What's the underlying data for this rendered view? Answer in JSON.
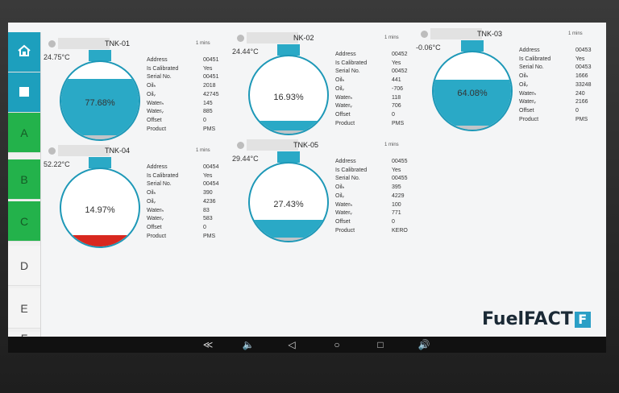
{
  "sidebar": {
    "items": [
      {
        "label": "⌂",
        "icon": "home-icon"
      },
      {
        "label": "■",
        "icon": "square-icon"
      },
      {
        "label": "A"
      },
      {
        "label": "B"
      },
      {
        "label": "C"
      },
      {
        "label": "D"
      },
      {
        "label": "E"
      },
      {
        "label": "F"
      }
    ]
  },
  "tanks": [
    {
      "name": "TNK-01",
      "mins": "1 mins",
      "temp": "24.75°C",
      "percent": "77.68%",
      "fill": 0.7768,
      "water_fill": 0.05,
      "info": [
        [
          "Address",
          "00451"
        ],
        [
          "Is Calibrated",
          "Yes"
        ],
        [
          "Serial No.",
          "00451"
        ],
        [
          "Oilₕ",
          "2018"
        ],
        [
          "Oilᵥ",
          "42745"
        ],
        [
          "Waterₕ",
          "145"
        ],
        [
          "Waterᵥ",
          "885"
        ],
        [
          "Offset",
          "0"
        ],
        [
          "Product",
          "PMS"
        ]
      ]
    },
    {
      "name": "NK-02",
      "mins": "1 mins",
      "temp": "24.44°C",
      "percent": "16.93%",
      "fill": 0.1693,
      "water_fill": 0.04,
      "info": [
        [
          "Address",
          "00452"
        ],
        [
          "Is Calibrated",
          "Yes"
        ],
        [
          "Serial No.",
          "00452"
        ],
        [
          "Oilₕ",
          "441"
        ],
        [
          "Oilᵥ",
          "-706"
        ],
        [
          "Waterₕ",
          "118"
        ],
        [
          "Waterᵥ",
          "706"
        ],
        [
          "Offset",
          "0"
        ],
        [
          "Product",
          "PMS"
        ]
      ]
    },
    {
      "name": "TNK-03",
      "mins": "1 mins",
      "temp": "-0.06°C",
      "percent": "64.08%",
      "fill": 0.6408,
      "water_fill": 0.05,
      "info": [
        [
          "Address",
          "00453"
        ],
        [
          "Is Calibrated",
          "Yes"
        ],
        [
          "Serial No.",
          "00453"
        ],
        [
          "Oilₕ",
          "1666"
        ],
        [
          "Oilᵥ",
          "33248"
        ],
        [
          "Waterₕ",
          "240"
        ],
        [
          "Waterᵥ",
          "2166"
        ],
        [
          "Offset",
          "0"
        ],
        [
          "Product",
          "PMS"
        ]
      ]
    },
    {
      "name": "TNK-04",
      "mins": "1 mins",
      "temp": "52.22°C",
      "percent": "14.97%",
      "fill": 0.1497,
      "water_fill": 0.0,
      "fill_color": "#d8281f",
      "info": [
        [
          "Address",
          "00454"
        ],
        [
          "Is Calibrated",
          "Yes"
        ],
        [
          "Serial No.",
          "00454"
        ],
        [
          "Oilₕ",
          "390"
        ],
        [
          "Oilᵥ",
          "4236"
        ],
        [
          "Waterₕ",
          "83"
        ],
        [
          "Waterᵥ",
          "583"
        ],
        [
          "Offset",
          "0"
        ],
        [
          "Product",
          "PMS"
        ]
      ]
    },
    {
      "name": "TNK-05",
      "mins": "1 mins",
      "temp": "29.44°C",
      "percent": "27.43%",
      "fill": 0.2743,
      "water_fill": 0.04,
      "info": [
        [
          "Address",
          "00455"
        ],
        [
          "Is Calibrated",
          "Yes"
        ],
        [
          "Serial No.",
          "00455"
        ],
        [
          "Oilₕ",
          "395"
        ],
        [
          "Oilᵥ",
          "4229"
        ],
        [
          "Waterₕ",
          "100"
        ],
        [
          "Waterᵥ",
          "771"
        ],
        [
          "Offset",
          "0"
        ],
        [
          "Product",
          "KERO"
        ]
      ]
    }
  ],
  "logo": {
    "text": "FuelFACT",
    "mark": "F"
  },
  "navbar": {
    "buttons": [
      "≪",
      "🔈",
      "◁",
      "○",
      "□",
      "🔊"
    ]
  },
  "colors": {
    "accent": "#1d9fbd",
    "green": "#23b24b",
    "alarm": "#d8281f"
  }
}
